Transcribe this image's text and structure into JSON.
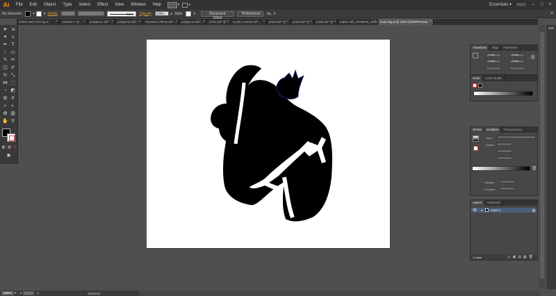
{
  "app": {
    "logo": "Ai"
  },
  "menu": [
    "File",
    "Edit",
    "Object",
    "Type",
    "Select",
    "Effect",
    "View",
    "Window",
    "Help"
  ],
  "workspace": "Essentials",
  "control_bar": {
    "selection": "No Selection",
    "stroke_label": "Stroke",
    "stroke_style": "Basic",
    "opacity_label": "Opacity",
    "opacity_value": "100%",
    "style_label": "Style",
    "document_setup": "Document Setup",
    "preferences": "Preferences"
  },
  "tabs": [
    {
      "label": "torbelt watch lcd img.ai",
      "active": false
    },
    {
      "label": "Untitled-1* @ ...",
      "active": false
    },
    {
      "label": "poltypeor1.dxf* ...",
      "active": false
    },
    {
      "label": "poltypeor2.dxf* ...",
      "active": false
    },
    {
      "label": "Plywood 2.78mm.dxf* ...",
      "active": false
    },
    {
      "label": "poltypeor3.dxf* ...",
      "active": false
    },
    {
      "label": "print1.dxf* @ ...",
      "active": false
    },
    {
      "label": "acrylic 3.15mm.dxf* ...",
      "active": false
    },
    {
      "label": "print2.dxf* @ ...",
      "active": false
    },
    {
      "label": "print3.dxf* @ ...",
      "active": false
    },
    {
      "label": "print4.dxf* @ ...",
      "active": false
    },
    {
      "label": "Kakao Talk_20180205_161241960.jpg* ...",
      "active": false
    },
    {
      "label": "heart img.ai @ 100% (RGB/Preview)",
      "active": true
    }
  ],
  "transform_panel": {
    "tabs": [
      "Transform",
      "Align",
      "Pathfinder"
    ],
    "x": "0 mm",
    "y": "0 mm",
    "w": "0 mm",
    "h": "0 mm"
  },
  "color_panel": {
    "tabs": [
      "Color",
      "Color Guide"
    ]
  },
  "gradient_panel": {
    "tabs": [
      "Stroke",
      "Gradient",
      "Transparency"
    ],
    "type_label": "Type:",
    "stroke_label": "Stroke:",
    "opacity_label": "Opacity:",
    "location_label": "Location:"
  },
  "layers_panel": {
    "tabs": [
      "Layers",
      "Artboards"
    ],
    "layer_name": "Layer 1",
    "footer": "1 Layer"
  },
  "status": {
    "zoom": "100%",
    "mode": "Selection"
  },
  "colors": {
    "accent": "#e09a3e",
    "chrome": "#3c3c3c",
    "canvas": "#4f4f4f"
  }
}
